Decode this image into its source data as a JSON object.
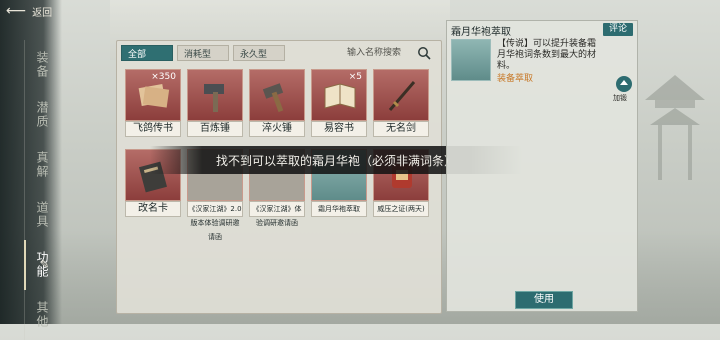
{
  "header": {
    "back_label": "返回"
  },
  "nav": {
    "items": [
      {
        "label": "装备",
        "active": false
      },
      {
        "label": "潜质",
        "active": false
      },
      {
        "label": "真解",
        "active": false
      },
      {
        "label": "道具",
        "active": false
      },
      {
        "label": "功能",
        "active": true
      },
      {
        "label": "其他",
        "active": false
      }
    ]
  },
  "tabs": [
    {
      "label": "全部",
      "active": true
    },
    {
      "label": "消耗型",
      "active": false
    },
    {
      "label": "永久型",
      "active": false
    }
  ],
  "search": {
    "placeholder": "输入名称搜索"
  },
  "items": [
    {
      "name": "飞鸽传书",
      "count": "×350",
      "icon": "letters-icon"
    },
    {
      "name": "百炼锤",
      "count": "",
      "icon": "hammer-icon"
    },
    {
      "name": "淬火锤",
      "count": "",
      "icon": "fire-hammer-icon"
    },
    {
      "name": "易容书",
      "count": "×5",
      "icon": "book-icon"
    },
    {
      "name": "无名剑",
      "count": "",
      "icon": "sword-icon"
    },
    {
      "name": "改名卡",
      "count": "",
      "icon": "rename-card-icon"
    },
    {
      "name": "《汉家江湖》2.0版本体验调研邀请函",
      "count": "",
      "icon": "invitation-icon"
    },
    {
      "name": "《汉家江湖》体验调研邀请函",
      "count": "",
      "icon": "invitation-icon"
    },
    {
      "name": "霜月华袍萃取",
      "count": "",
      "icon": "robe-icon"
    },
    {
      "name": "威压之证(两天)",
      "count": "",
      "icon": "badge-icon"
    }
  ],
  "toast": {
    "message": "找不到可以萃取的霜月华袍（必须非满词条）"
  },
  "detail": {
    "title": "霜月华袍萃取",
    "comment_label": "评论",
    "description": "【传说】可以提升装备霜月华袍词条数到最大的材料。",
    "tag": "装备萃取",
    "equip_label": "加锻",
    "use_label": "使用"
  },
  "colors": {
    "accent": "#2d6c70",
    "tile": "#8c3e3c",
    "tag": "#c87a2a"
  }
}
